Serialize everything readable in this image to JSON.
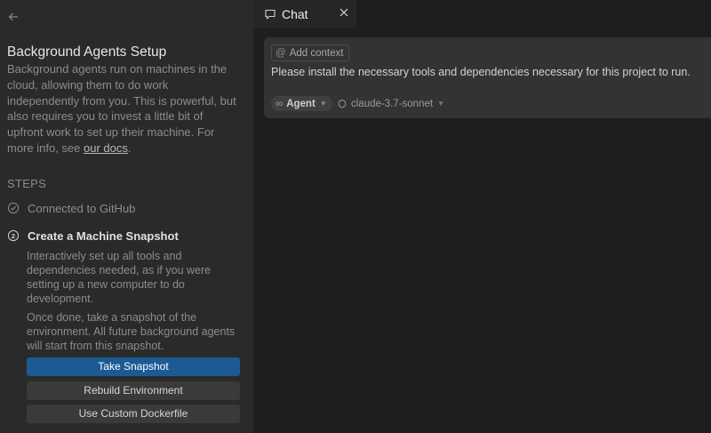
{
  "sidebar": {
    "title": "Background Agents Setup",
    "description": "Background agents run on machines in the cloud, allowing them to do work independently from you. This is powerful, but also requires you to invest a little bit of upfront work to set up their machine. For more info, see ",
    "docs_link": "our docs",
    "period": ".",
    "steps_heading": "STEPS",
    "steps": [
      {
        "label": "Connected to GitHub",
        "status": "done"
      },
      {
        "label": "Create a Machine Snapshot",
        "status": "current",
        "number": "2"
      }
    ],
    "step2_text1": "Interactively set up all tools and dependencies needed, as if you were setting up a new computer to do development.",
    "step2_text2": "Once done, take a snapshot of the environment. All future background agents will start from this snapshot.",
    "buttons": {
      "take_snapshot": "Take Snapshot",
      "rebuild": "Rebuild Environment",
      "custom_dockerfile": "Use Custom Dockerfile"
    }
  },
  "chat": {
    "tab_label": "Chat",
    "add_context": "Add context",
    "prompt": "Please install the necessary tools and dependencies necessary for this project to run.",
    "mode": "Agent",
    "model": "claude-3.7-sonnet"
  },
  "icons": {
    "back": "arrow-left-icon",
    "check": "check-circle-icon",
    "chat": "chat-bubble-icon",
    "close": "close-icon",
    "infinity": "infinity-icon",
    "model": "brain-icon"
  },
  "colors": {
    "primary_button": "#1b5a94",
    "background": "#1e1e1e",
    "sidebar": "#2a2a2a"
  }
}
